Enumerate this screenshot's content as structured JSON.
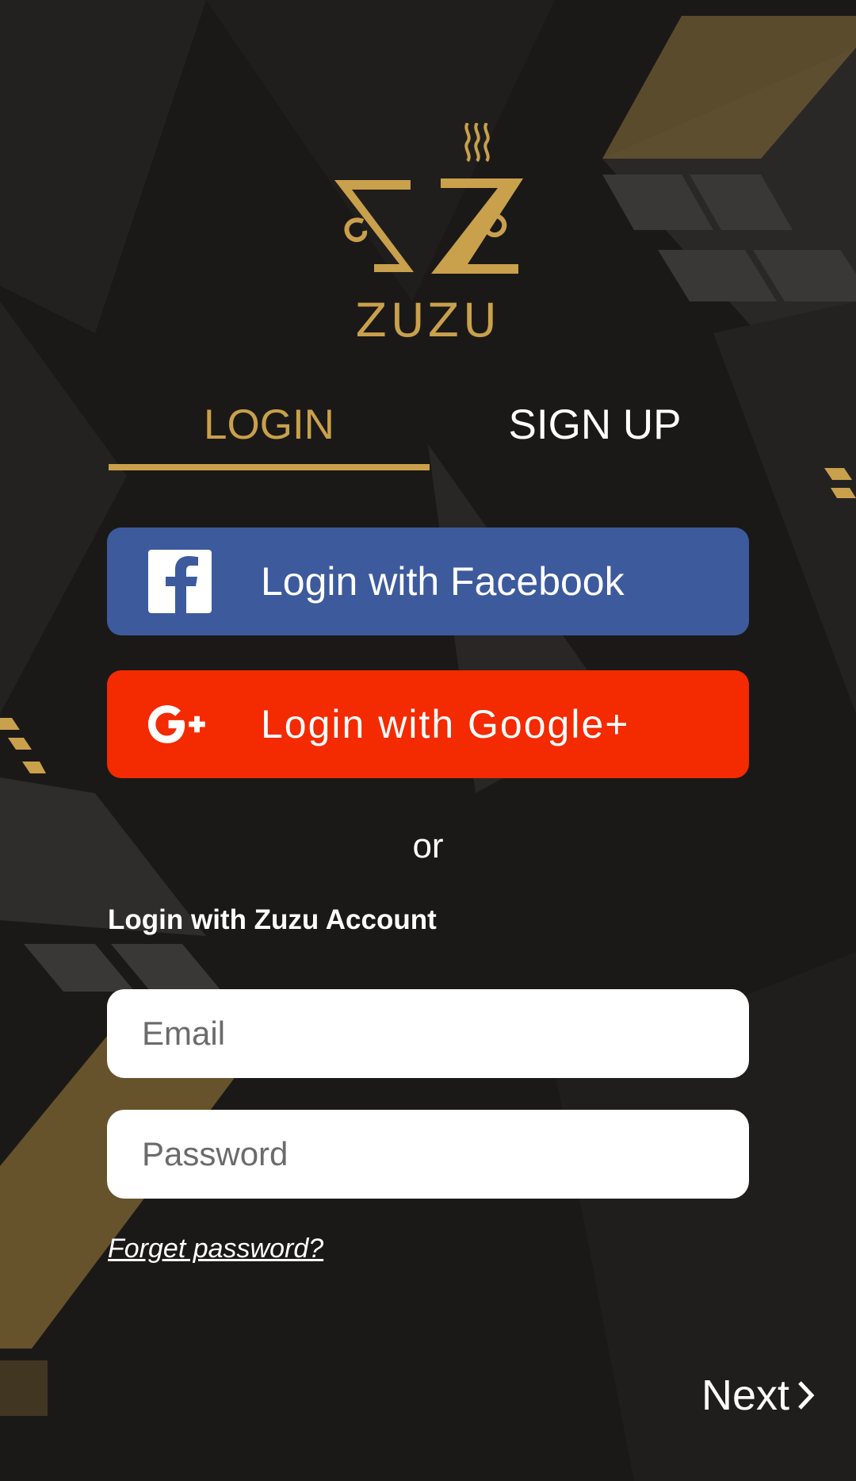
{
  "brand": {
    "name": "ZUZU"
  },
  "tabs": {
    "login_label": "LOGIN",
    "signup_label": "SIGN UP"
  },
  "social": {
    "facebook_label": "Login with Facebook",
    "google_label": "Login with Google+"
  },
  "divider_text": "or",
  "account_section": {
    "title": "Login with Zuzu Account"
  },
  "form": {
    "email_placeholder": "Email",
    "password_placeholder": "Password"
  },
  "links": {
    "forgot_password": "Forget password?"
  },
  "footer": {
    "next_label": "Next"
  },
  "colors": {
    "gold": "#c9a04b",
    "facebook_blue": "#3d5a9c",
    "google_red": "#f42a00",
    "background": "#1b1918"
  },
  "icons": [
    "steaming-cup-logo-icon",
    "facebook-icon",
    "google-plus-icon",
    "chevron-right-icon"
  ]
}
